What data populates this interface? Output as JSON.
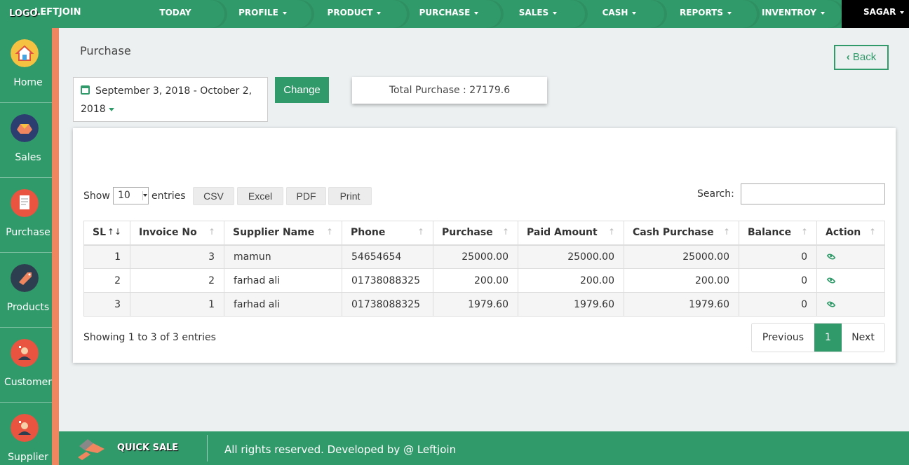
{
  "brand": {
    "logo_text": "LOGO",
    "name": "LEFTJOIN"
  },
  "nav": {
    "items": [
      {
        "label": "TODAY",
        "dropdown": false
      },
      {
        "label": "PROFILE",
        "dropdown": true
      },
      {
        "label": "PRODUCT",
        "dropdown": true
      },
      {
        "label": "PURCHASE",
        "dropdown": true
      },
      {
        "label": "SALES",
        "dropdown": true
      },
      {
        "label": "CASH",
        "dropdown": true
      },
      {
        "label": "REPORTS",
        "dropdown": true
      },
      {
        "label": "INVENTROY",
        "dropdown": true
      }
    ],
    "user": "SAGAR"
  },
  "sidebar": {
    "items": [
      {
        "label": "Home",
        "icon": "home-icon"
      },
      {
        "label": "Sales",
        "icon": "sales-icon"
      },
      {
        "label": "Purchase",
        "icon": "purchase-icon"
      },
      {
        "label": "Products",
        "icon": "products-icon"
      },
      {
        "label": "Customer",
        "icon": "customer-icon"
      },
      {
        "label": "Supplier",
        "icon": "supplier-icon"
      }
    ]
  },
  "page": {
    "title": "Purchase",
    "back_label": "Back",
    "date_range": "September 3, 2018 - October 2, 2018",
    "change_label": "Change",
    "total_purchase": "Total Purchase : 27179.6"
  },
  "table_controls": {
    "show_label": "Show",
    "page_size": "10",
    "entries_label": "entries",
    "export_buttons": [
      "CSV",
      "Excel",
      "PDF",
      "Print"
    ],
    "search_label": "Search:",
    "search_value": ""
  },
  "table": {
    "columns": [
      "SL",
      "Invoice No",
      "Supplier Name",
      "Phone",
      "Purchase",
      "Paid Amount",
      "Cash Purchase",
      "Balance",
      "Action"
    ],
    "rows": [
      {
        "sl": "1",
        "invoice": "3",
        "supplier": "mamun",
        "phone": "54654654",
        "purchase": "25000.00",
        "paid": "25000.00",
        "cash": "25000.00",
        "balance": "0"
      },
      {
        "sl": "2",
        "invoice": "2",
        "supplier": "farhad ali",
        "phone": "01738088325",
        "purchase": "200.00",
        "paid": "200.00",
        "cash": "200.00",
        "balance": "0"
      },
      {
        "sl": "3",
        "invoice": "1",
        "supplier": "farhad ali",
        "phone": "01738088325",
        "purchase": "1979.60",
        "paid": "1979.60",
        "cash": "1979.60",
        "balance": "0"
      }
    ],
    "info": "Showing 1 to 3 of 3 entries"
  },
  "pagination": {
    "previous": "Previous",
    "current": "1",
    "next": "Next"
  },
  "footer": {
    "quick_sale": "QUICK SALE",
    "copyright": "All rights reserved. Developed by @ Leftjoin"
  },
  "colors": {
    "primary": "#319a6a",
    "accent": "#f0865f",
    "user_bg": "#000000"
  }
}
